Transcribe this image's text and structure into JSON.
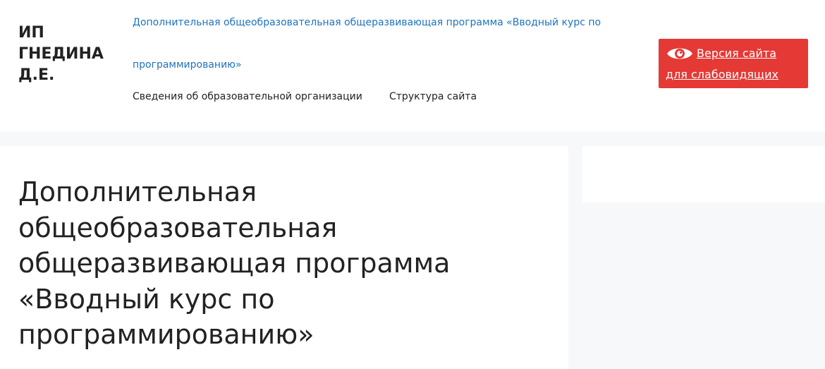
{
  "header": {
    "site_title": "ИП ГНЕДИНА Д.Е.",
    "nav": {
      "program_link": "Дополнительная общеобразовательная общеразвивающая программа «Вводный курс по программированию»",
      "items": [
        {
          "label": "Сведения об образовательной организации"
        },
        {
          "label": "Структура сайта"
        }
      ]
    },
    "accessibility": {
      "label": "Версия сайта для слабовидящих",
      "icon": "eye-icon"
    }
  },
  "main": {
    "title": "Дополнительная общеобразовательная общеразвивающая программа «Вводный курс по программированию»"
  },
  "colors": {
    "link": "#1e73be",
    "accessibility_bg": "#e53935",
    "page_bg": "#f7f8f9",
    "text": "#222222"
  }
}
